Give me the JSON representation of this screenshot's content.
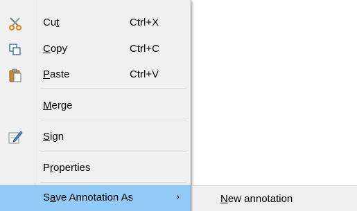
{
  "context_menu": {
    "items": [
      {
        "id": "cut",
        "icon": "scissors-icon",
        "label_pre": "Cu",
        "label_ul": "t",
        "label_post": "",
        "shortcut": "Ctrl+X"
      },
      {
        "id": "copy",
        "icon": "copy-icon",
        "label_pre": "",
        "label_ul": "C",
        "label_post": "opy",
        "shortcut": "Ctrl+C"
      },
      {
        "id": "paste",
        "icon": "paste-icon",
        "label_pre": "",
        "label_ul": "P",
        "label_post": "aste",
        "shortcut": "Ctrl+V"
      },
      {
        "id": "merge",
        "icon": "",
        "label_pre": "",
        "label_ul": "M",
        "label_post": "erge",
        "shortcut": ""
      },
      {
        "id": "sign",
        "icon": "sign-pen-icon",
        "label_pre": "",
        "label_ul": "S",
        "label_post": "ign",
        "shortcut": ""
      },
      {
        "id": "properties",
        "icon": "",
        "label_pre": "P",
        "label_ul": "r",
        "label_post": "operties",
        "shortcut": ""
      },
      {
        "id": "save-annotation-as",
        "icon": "",
        "label_pre": "S",
        "label_ul": "a",
        "label_post": "ve Annotation As",
        "shortcut": "",
        "submenu_arrow": "›",
        "highlighted": true
      }
    ]
  },
  "submenu": {
    "items": [
      {
        "id": "new-annotation",
        "label_pre": "",
        "label_ul": "N",
        "label_post": "ew annotation"
      }
    ]
  },
  "colors": {
    "menu_bg": "#f0f0f0",
    "highlight": "#91c9f7",
    "separator": "#d4d4d4"
  }
}
